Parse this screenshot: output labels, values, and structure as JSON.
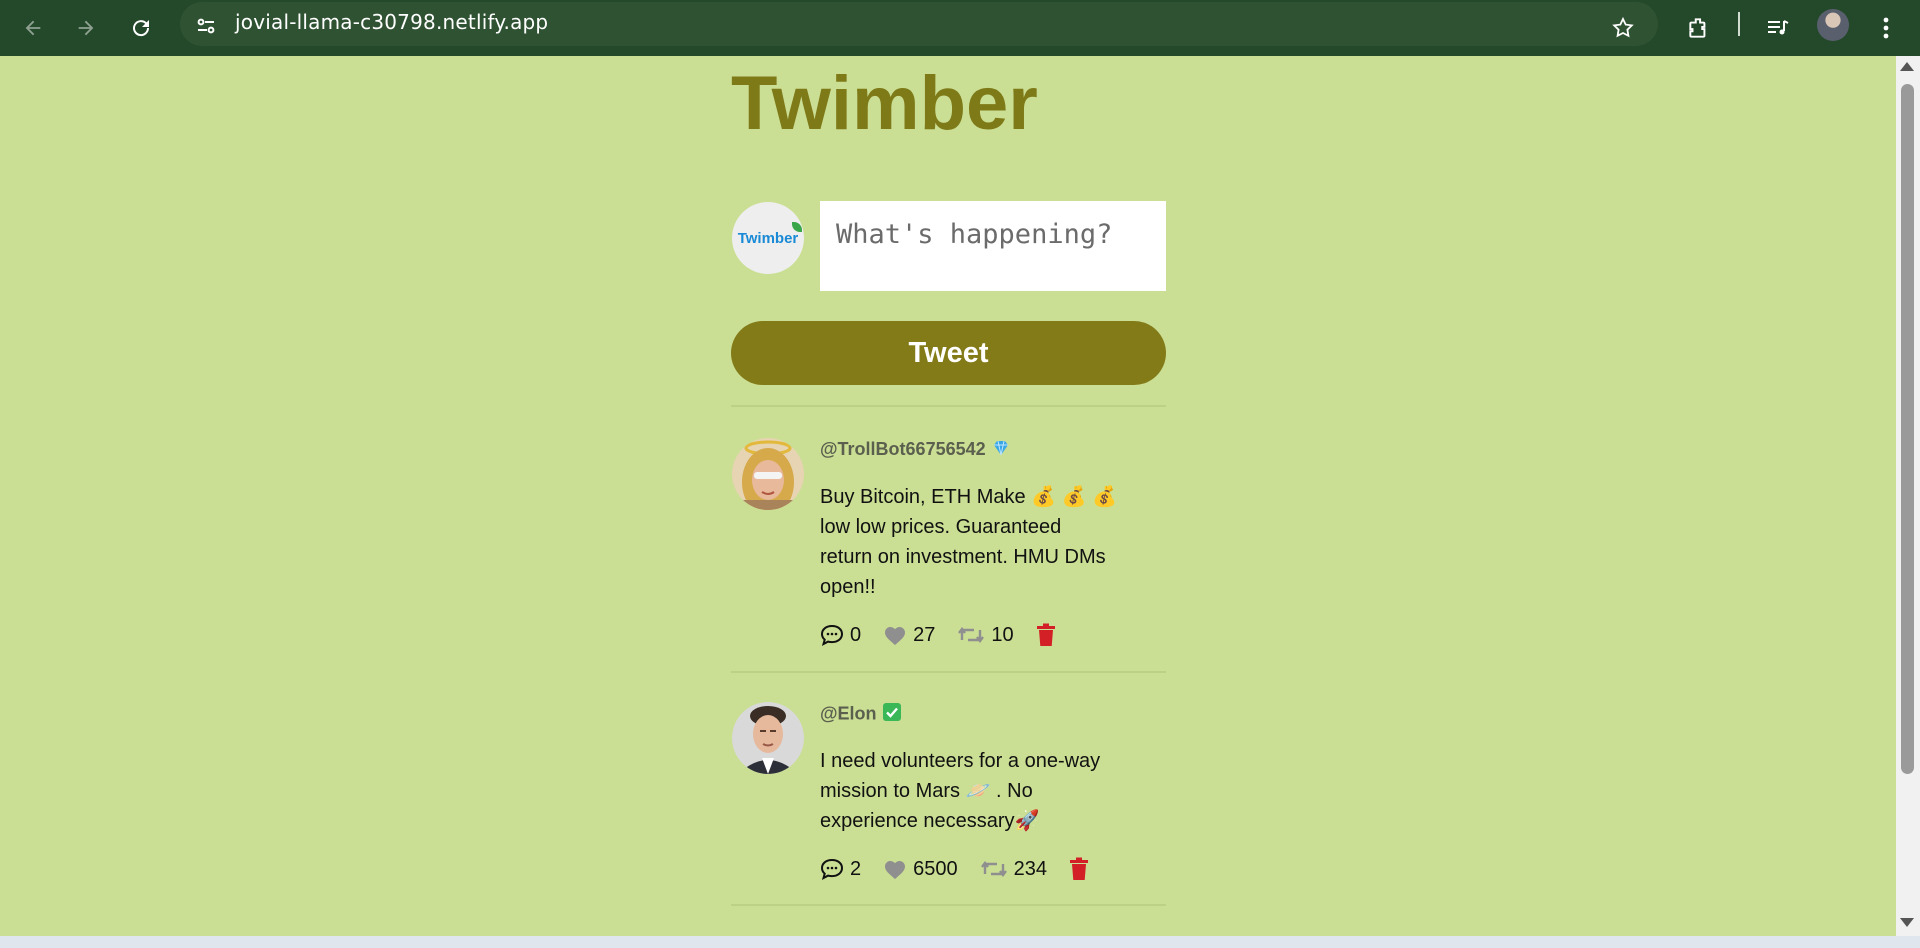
{
  "browser": {
    "url": "jovial-llama-c30798.netlify.app"
  },
  "app": {
    "title": "Twimber",
    "logo_text": "Twimber",
    "composer_placeholder": "What's happening?",
    "tweet_button": "Tweet"
  },
  "colors": {
    "background": "#cadf94",
    "accent": "#837a18",
    "title": "#7f7a18",
    "delete": "#d31f26"
  },
  "posts": [
    {
      "handle": "@TrollBot66756542",
      "badge_icon": "gem-icon",
      "text": "Buy Bitcoin, ETH Make 💰 💰 💰\nlow low prices. Guaranteed\nreturn on investment. HMU DMs\nopen!!",
      "replies": "0",
      "likes": "27",
      "retweets": "10"
    },
    {
      "handle": "@Elon",
      "badge_icon": "verified-check-icon",
      "text": "I need volunteers for a one-way\nmission to Mars 🪐 . No\nexperience necessary🚀",
      "replies": "2",
      "likes": "6500",
      "retweets": "234"
    }
  ]
}
